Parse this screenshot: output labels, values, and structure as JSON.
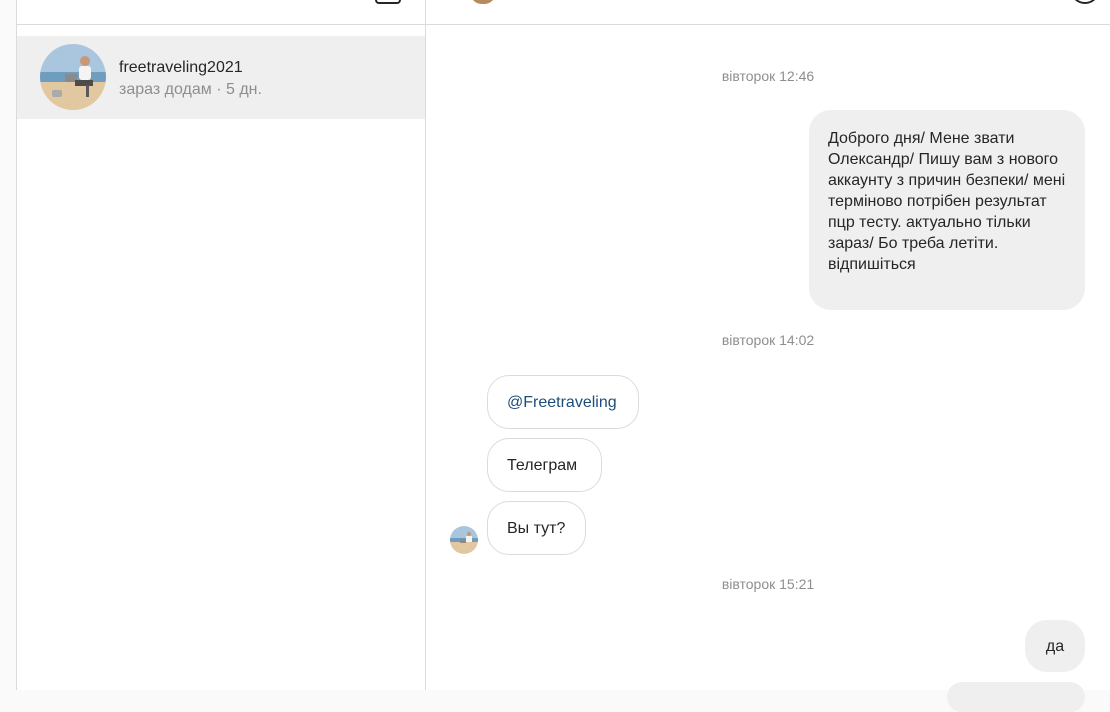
{
  "inbox": {
    "threads": [
      {
        "username": "freetraveling2021",
        "status": "зараз додам · 5 дн."
      }
    ]
  },
  "conversation": {
    "messages": [
      {
        "type": "timestamp",
        "text": "вівторок 12:46"
      },
      {
        "type": "outgoing",
        "text": "Доброго дня/ Мене звати Олександр/ Пишу вам з нового аккаунту з причин безпеки/ мені терміново потрібен результат пцр тесту. актуально тільки зараз/ Бо треба летіти. відпишіться"
      },
      {
        "type": "timestamp",
        "text": "вівторок 14:02"
      },
      {
        "type": "incoming",
        "text": "@Freetraveling"
      },
      {
        "type": "incoming",
        "text": "Телеграм"
      },
      {
        "type": "incoming",
        "text": "Вы тут?"
      },
      {
        "type": "timestamp",
        "text": "вівторок 15:21"
      },
      {
        "type": "outgoing",
        "text": "да"
      }
    ]
  },
  "icons": {
    "compose": "compose-icon",
    "info": "info-icon"
  },
  "colors": {
    "link": "#1f4d7a",
    "muted": "#8e8e8e",
    "selected_thread": "#efefef",
    "border": "#dbdbdb"
  }
}
